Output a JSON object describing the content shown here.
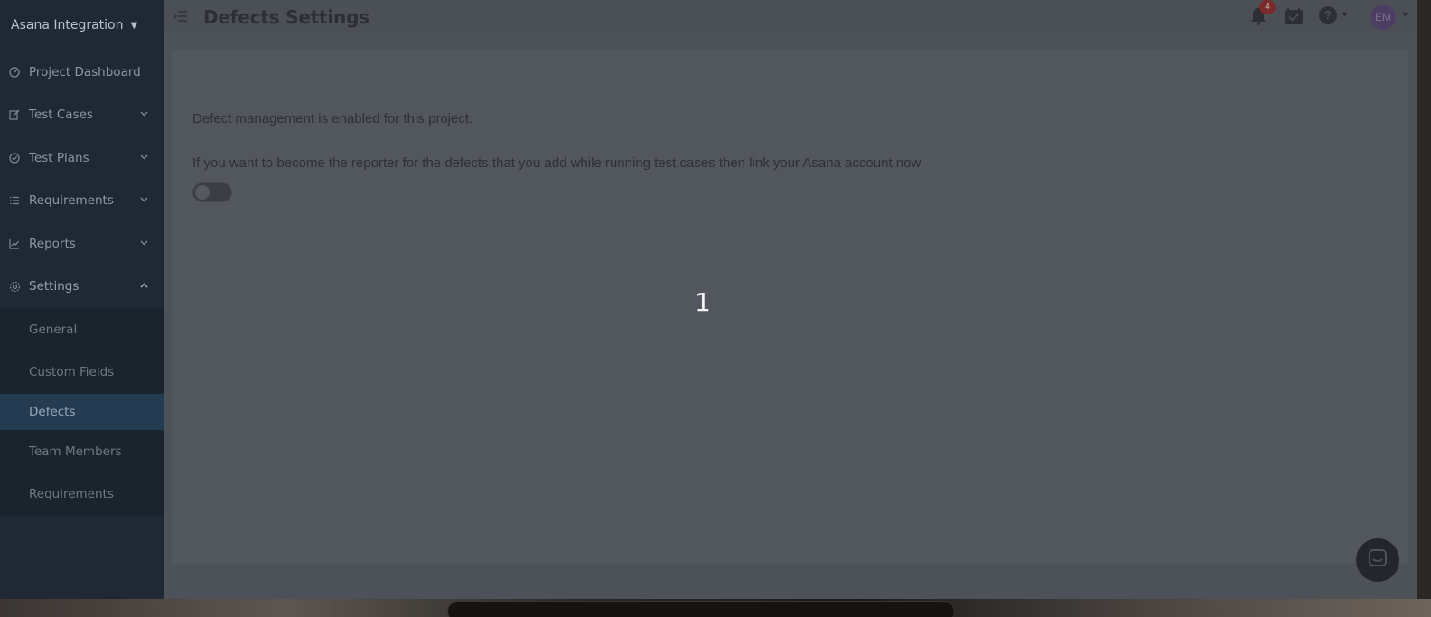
{
  "project": {
    "name": "Asana Integration"
  },
  "sidebar": {
    "items": [
      {
        "label": "Project Dashboard",
        "icon": "dashboard-icon"
      },
      {
        "label": "Test Cases",
        "icon": "edit-icon"
      },
      {
        "label": "Test Plans",
        "icon": "check-circle-icon"
      },
      {
        "label": "Requirements",
        "icon": "list-icon"
      },
      {
        "label": "Reports",
        "icon": "chart-icon"
      },
      {
        "label": "Settings",
        "icon": "gear-icon"
      }
    ],
    "settings_sub": [
      {
        "label": "General"
      },
      {
        "label": "Custom Fields"
      },
      {
        "label": "Defects"
      },
      {
        "label": "Team Members"
      },
      {
        "label": "Requirements"
      }
    ]
  },
  "header": {
    "title": "Defects Settings",
    "notifications_count": "4",
    "avatar_initials": "EM"
  },
  "main": {
    "enabled_text": "Defect management is enabled for this project.",
    "link_text": "If you want to become the reporter for the defects that you add while running test cases then link your Asana account now",
    "toggle_on": false
  },
  "overlay": {
    "step_number": "1"
  },
  "colors": {
    "sidebar_bg": "#1f2935",
    "active_item_bg": "#253b52",
    "badge": "#7a2a2a",
    "avatar_bg": "#4e3d63"
  }
}
